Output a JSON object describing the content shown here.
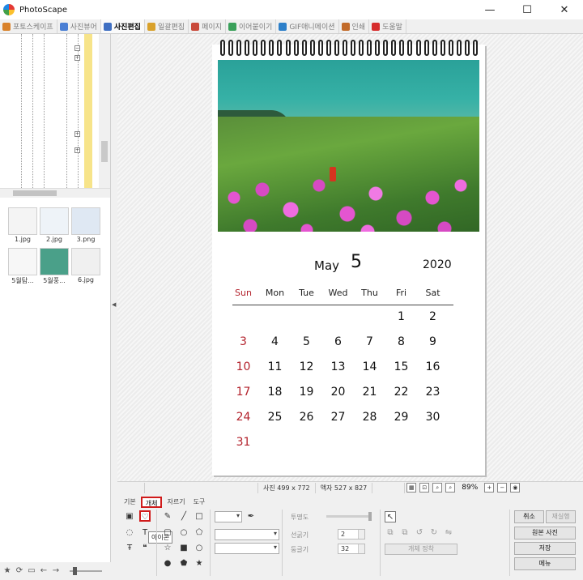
{
  "window": {
    "title": "PhotoScape",
    "controls": {
      "minimize": "—",
      "maximize": "☐",
      "close": "✕"
    }
  },
  "tabs": [
    {
      "label": "포토스케이프",
      "active": false,
      "color": "#d9822b"
    },
    {
      "label": "사진뷰어",
      "active": false,
      "color": "#4a7fd4"
    },
    {
      "label": "사진편집",
      "active": true,
      "color": "#3f6fc2"
    },
    {
      "label": "일괄편집",
      "active": false,
      "color": "#d9a12b"
    },
    {
      "label": "페이지",
      "active": false,
      "color": "#c94a3b"
    },
    {
      "label": "이어붙이기",
      "active": false,
      "color": "#3aa05a"
    },
    {
      "label": "GIF애니메이션",
      "active": false,
      "color": "#2c7fc9"
    },
    {
      "label": "인쇄",
      "active": false,
      "color": "#c26b2a"
    },
    {
      "label": "도움말",
      "active": false,
      "color": "#d62c2c"
    }
  ],
  "thumbnails": [
    {
      "label": "1.jpg"
    },
    {
      "label": "2.jpg"
    },
    {
      "label": "3.png"
    },
    {
      "label": "5월탐..."
    },
    {
      "label": "5월풍..."
    },
    {
      "label": "6.jpg"
    }
  ],
  "calendar": {
    "month": "May",
    "month_number": "5",
    "year": "2020",
    "weekdays": [
      "Sun",
      "Mon",
      "Tue",
      "Wed",
      "Thu",
      "Fri",
      "Sat"
    ],
    "weeks": [
      [
        "",
        "",
        "",
        "",
        "",
        "1",
        "2"
      ],
      [
        "3",
        "4",
        "5",
        "6",
        "7",
        "8",
        "9"
      ],
      [
        "10",
        "11",
        "12",
        "13",
        "14",
        "15",
        "16"
      ],
      [
        "17",
        "18",
        "19",
        "20",
        "21",
        "22",
        "23"
      ],
      [
        "24",
        "25",
        "26",
        "27",
        "28",
        "29",
        "30"
      ],
      [
        "31",
        "",
        "",
        "",
        "",
        "",
        ""
      ]
    ],
    "sunday_color": "#b3222c"
  },
  "status": {
    "photo_size": "사진 499 x 772",
    "frame_size": "액자 527 x 827",
    "zoom": "89%"
  },
  "tool_panel": {
    "subtabs": [
      "기본",
      "개체",
      "자르기",
      "도구"
    ],
    "active_subtab": "개체",
    "tooltip": "아이콘",
    "labels": {
      "opacity": "투명도",
      "line_width": "선굵기",
      "round": "둥글기"
    },
    "line_width_value": "2",
    "round_value": "32",
    "object_fix": "개체 정착",
    "buttons": {
      "undo": "취소",
      "redo": "재실행",
      "original": "원본 사진",
      "save": "저장",
      "menu": "메뉴"
    }
  }
}
